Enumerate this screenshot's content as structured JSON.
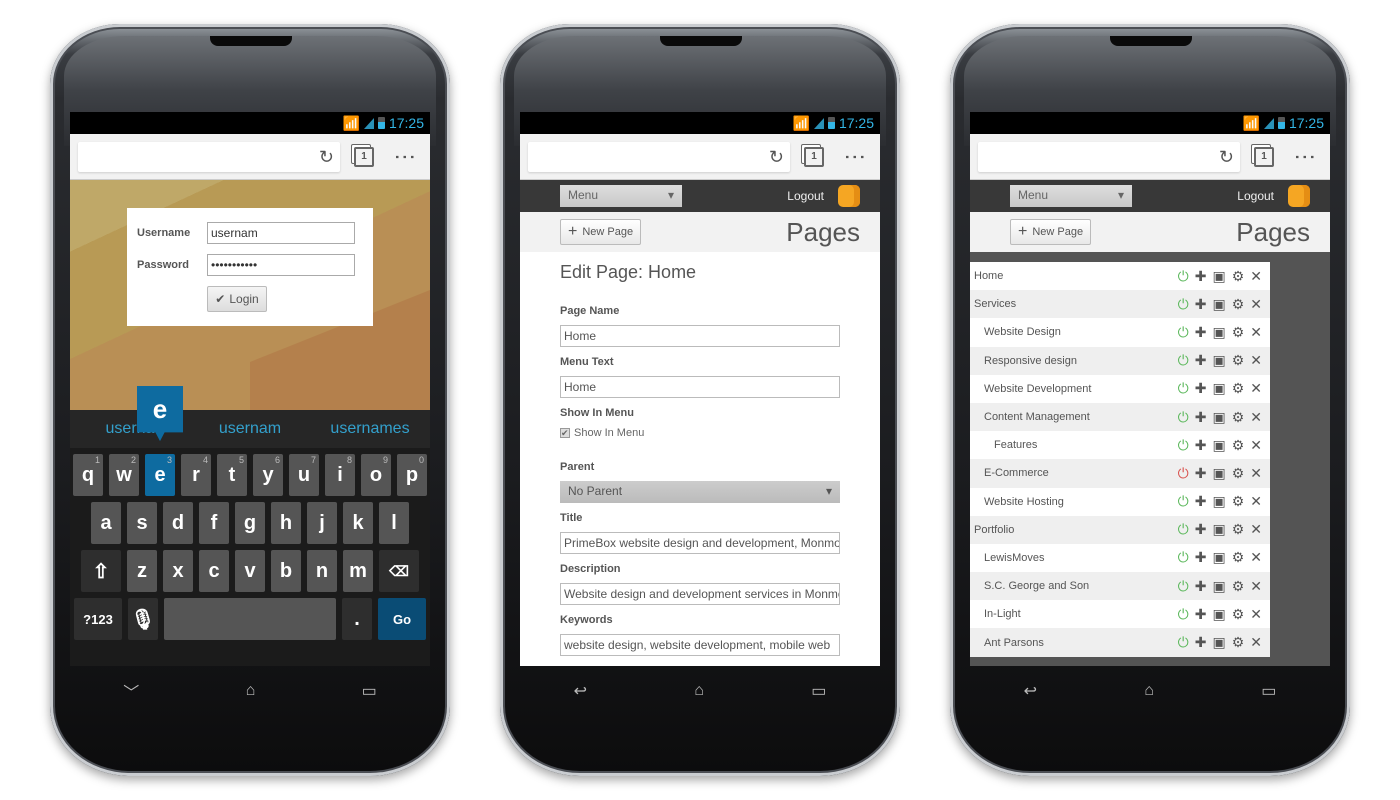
{
  "status": {
    "time": "17:25"
  },
  "browser": {
    "tab_count": "1"
  },
  "phone1": {
    "login": {
      "username_label": "Username",
      "username_value": "usernam",
      "password_label": "Password",
      "password_value": "•••••••••••",
      "login_button": "Login"
    },
    "suggestions": [
      "userna",
      "usernam",
      "usernames"
    ],
    "popup_key": "e",
    "keyboard": {
      "row1": [
        {
          "k": "q",
          "h": "1"
        },
        {
          "k": "w",
          "h": "2"
        },
        {
          "k": "e",
          "h": "3"
        },
        {
          "k": "r",
          "h": "4"
        },
        {
          "k": "t",
          "h": "5"
        },
        {
          "k": "y",
          "h": "6"
        },
        {
          "k": "u",
          "h": "7"
        },
        {
          "k": "i",
          "h": "8"
        },
        {
          "k": "o",
          "h": "9"
        },
        {
          "k": "p",
          "h": "0"
        }
      ],
      "row2": [
        "a",
        "s",
        "d",
        "f",
        "g",
        "h",
        "j",
        "k",
        "l"
      ],
      "row3": [
        "z",
        "x",
        "c",
        "v",
        "b",
        "n",
        "m"
      ],
      "symbols": "?123",
      "period": ".",
      "go": "Go"
    }
  },
  "admin": {
    "menu": "Menu",
    "logout": "Logout",
    "new_page": "New Page",
    "pages_title": "Pages"
  },
  "phone2": {
    "heading": "Edit Page: Home",
    "page_name_label": "Page Name",
    "page_name": "Home",
    "menu_text_label": "Menu Text",
    "menu_text": "Home",
    "show_in_menu_label": "Show In Menu",
    "show_in_menu_check": "Show In Menu",
    "parent_label": "Parent",
    "parent": "No Parent",
    "title_label": "Title",
    "title": "PrimeBox website design and development, Monmouth",
    "description_label": "Description",
    "description": "Website design and development services in Monmouth",
    "keywords_label": "Keywords",
    "keywords": "website design, website development, mobile web"
  },
  "phone3": {
    "pages": [
      {
        "name": "Home",
        "level": 0,
        "active": true
      },
      {
        "name": "Services",
        "level": 0,
        "active": true
      },
      {
        "name": "Website Design",
        "level": 1,
        "active": true
      },
      {
        "name": "Responsive design",
        "level": 1,
        "active": true
      },
      {
        "name": "Website Development",
        "level": 1,
        "active": true
      },
      {
        "name": "Content Management",
        "level": 1,
        "active": true
      },
      {
        "name": "Features",
        "level": 2,
        "active": true
      },
      {
        "name": "E-Commerce",
        "level": 1,
        "active": false
      },
      {
        "name": "Website Hosting",
        "level": 1,
        "active": true
      },
      {
        "name": "Portfolio",
        "level": 0,
        "active": true
      },
      {
        "name": "LewisMoves",
        "level": 1,
        "active": true
      },
      {
        "name": "S.C. George and Son",
        "level": 1,
        "active": true
      },
      {
        "name": "In-Light",
        "level": 1,
        "active": true
      },
      {
        "name": "Ant Parsons",
        "level": 1,
        "active": true
      }
    ]
  }
}
